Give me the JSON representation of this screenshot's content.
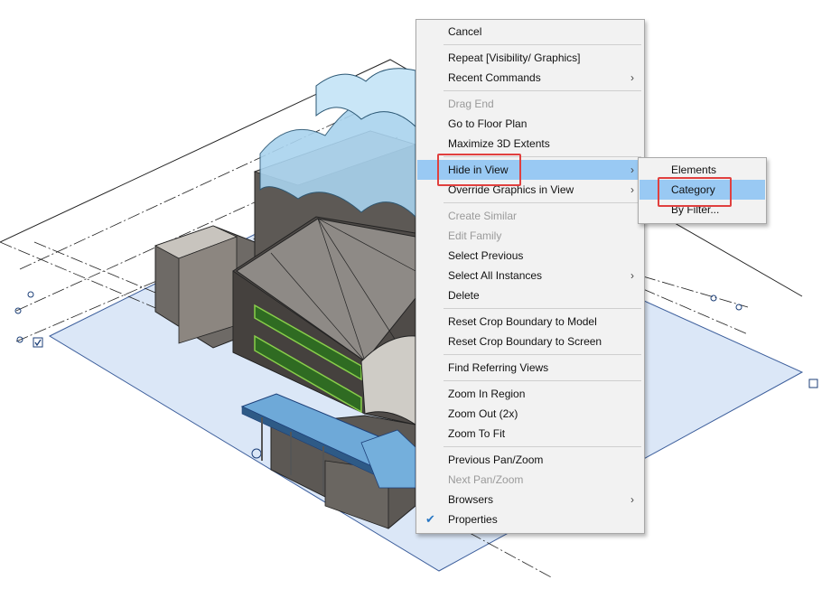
{
  "context_menu": {
    "items": [
      {
        "label": "Cancel"
      },
      {
        "label": "Repeat [Visibility/ Graphics]"
      },
      {
        "label": "Recent Commands"
      },
      {
        "label": "Drag End"
      },
      {
        "label": "Go to Floor Plan"
      },
      {
        "label": "Maximize 3D Extents"
      },
      {
        "label": "Hide in View"
      },
      {
        "label": "Override Graphics in View"
      },
      {
        "label": "Create Similar"
      },
      {
        "label": "Edit Family"
      },
      {
        "label": "Select Previous"
      },
      {
        "label": "Select All Instances"
      },
      {
        "label": "Delete"
      },
      {
        "label": "Reset Crop Boundary to Model"
      },
      {
        "label": "Reset Crop Boundary to Screen"
      },
      {
        "label": "Find Referring Views"
      },
      {
        "label": "Zoom In Region"
      },
      {
        "label": "Zoom Out (2x)"
      },
      {
        "label": "Zoom To Fit"
      },
      {
        "label": "Previous Pan/Zoom"
      },
      {
        "label": "Next Pan/Zoom"
      },
      {
        "label": "Browsers"
      },
      {
        "label": "Properties"
      }
    ]
  },
  "submenu": {
    "items": [
      {
        "label": "Elements"
      },
      {
        "label": "Category"
      },
      {
        "label": "By Filter..."
      }
    ]
  },
  "icons": {
    "submenu_arrow": "chevron-right-icon",
    "properties_check": "check-icon",
    "view_checkbox": "checkbox-checked-icon",
    "crop_handle": "square-handle-icon"
  },
  "colors": {
    "menu_bg": "#f2f2f2",
    "highlight": "#99c9f3",
    "callout": "#e0403f",
    "disabled_text": "#9a9a9a",
    "crop_region": "#dbe7f7",
    "glass": "#a9d3ee"
  }
}
